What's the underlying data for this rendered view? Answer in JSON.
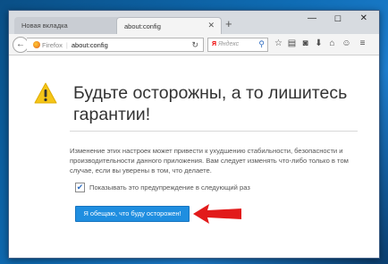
{
  "tabs": [
    {
      "label": "Новая вкладка",
      "active": false
    },
    {
      "label": "about:config",
      "active": true
    }
  ],
  "toolbar": {
    "identity_label": "Firefox",
    "url": "about:config",
    "search_placeholder": "Яндекс",
    "search_engine_letter": "Я"
  },
  "window_controls": {
    "minimize": "—",
    "maximize": "☐",
    "close": "✕"
  },
  "warning": {
    "title": "Будьте осторожны, а то лишитесь гарантии!",
    "description": "Изменение этих настроек может привести к ухудшению стабильности, безопасности и производительности данного приложения. Вам следует изменять что-либо только в том случае, если вы уверены в том, что делаете.",
    "checkbox_label": "Показывать это предупреждение в следующий раз",
    "checkbox_checked": true,
    "accept_button": "Я обещаю, что буду осторожен!"
  },
  "icons": {
    "warning": "warning-triangle-icon",
    "arrow": "red-arrow-pointer-icon",
    "nav": [
      "star-icon",
      "clipboard-icon",
      "pocket-icon",
      "download-icon",
      "home-icon",
      "chat-icon",
      "menu-icon"
    ]
  },
  "colors": {
    "accent": "#1f8ee0",
    "warning": "#f5c518",
    "arrow": "#e21b1b"
  }
}
